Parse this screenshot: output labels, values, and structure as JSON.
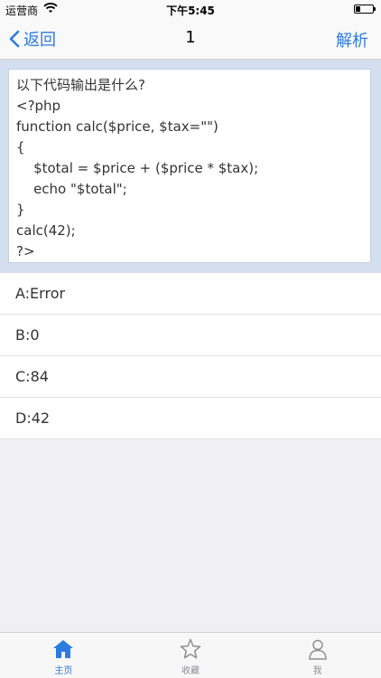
{
  "status_bar": {
    "carrier": "运营商",
    "time": "下午5:45",
    "wifi_icon": "wifi-icon",
    "battery_icon": "battery-icon"
  },
  "nav": {
    "back_label": "返回",
    "title": "1",
    "right_label": "解析"
  },
  "question": {
    "text": "以下代码输出是什么?\n<?php\nfunction calc($price, $tax=\"\")\n{\n    $total = $price + ($price * $tax);\n    echo \"$total\";\n}\ncalc(42);\n?>"
  },
  "options": [
    {
      "label": "A:Error"
    },
    {
      "label": "B:0"
    },
    {
      "label": "C:84"
    },
    {
      "label": "D:42"
    }
  ],
  "tabs": [
    {
      "label": "主页",
      "icon": "home-icon",
      "active": true
    },
    {
      "label": "收藏",
      "icon": "star-icon",
      "active": false
    },
    {
      "label": "我",
      "icon": "person-icon",
      "active": false
    }
  ],
  "colors": {
    "accent": "#2c7ce0",
    "question_bg": "#d3deef",
    "page_bg": "#efeff4"
  }
}
